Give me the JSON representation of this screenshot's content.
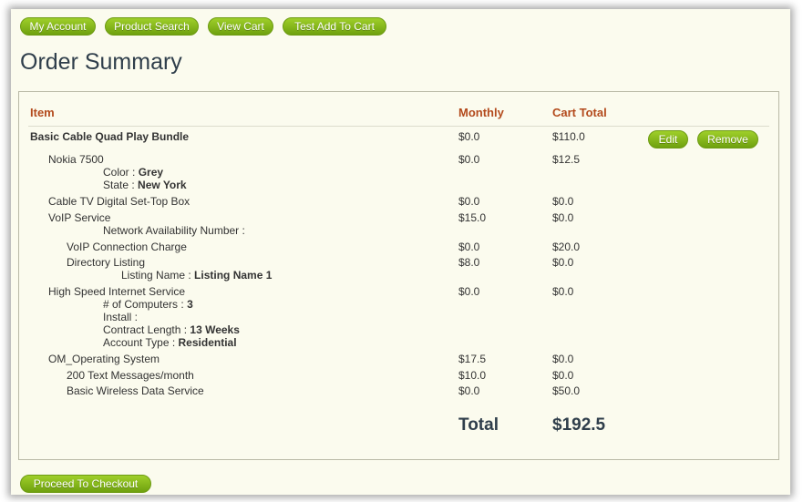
{
  "nav": {
    "my_account": "My Account",
    "product_search": "Product Search",
    "view_cart": "View Cart",
    "test_add": "Test Add To Cart"
  },
  "page_title": "Order Summary",
  "table": {
    "col_item": "Item",
    "col_monthly": "Monthly",
    "col_cart_total": "Cart Total",
    "bundle": {
      "name": "Basic Cable Quad Play Bundle",
      "monthly": "$0.0",
      "total": "$110.0",
      "edit": "Edit",
      "remove": "Remove"
    },
    "rows": [
      {
        "name": "Nokia 7500",
        "monthly": "$0.0",
        "total": "$12.5"
      },
      {
        "name": "Cable TV Digital Set-Top Box",
        "monthly": "$0.0",
        "total": "$0.0"
      },
      {
        "name": "VoIP Service",
        "monthly": "$15.0",
        "total": "$0.0"
      },
      {
        "name": "VoIP Connection Charge",
        "monthly": "$0.0",
        "total": "$20.0"
      },
      {
        "name": "Directory Listing",
        "monthly": "$8.0",
        "total": "$0.0"
      },
      {
        "name": "High Speed Internet Service",
        "monthly": "$0.0",
        "total": "$0.0"
      },
      {
        "name": "OM_Operating System",
        "monthly": "$17.5",
        "total": "$0.0"
      },
      {
        "name": "200 Text Messages/month",
        "monthly": "$10.0",
        "total": "$0.0"
      },
      {
        "name": "Basic Wireless Data Service",
        "monthly": "$0.0",
        "total": "$50.0"
      }
    ],
    "attrs": {
      "color_label": "Color :",
      "color_value": "Grey",
      "state_label": "State :",
      "state_value": "New York",
      "nan_label": "Network Availability Number :",
      "listing_label": "Listing Name :",
      "listing_value": "Listing Name 1",
      "computers_label": "# of Computers :",
      "computers_value": "3",
      "install_label": "Install :",
      "contract_label": "Contract Length :",
      "contract_value": "13 Weeks",
      "account_label": "Account Type :",
      "account_value": "Residential"
    },
    "total_label": "Total",
    "total_value": "$192.5"
  },
  "checkout": "Proceed To Checkout"
}
